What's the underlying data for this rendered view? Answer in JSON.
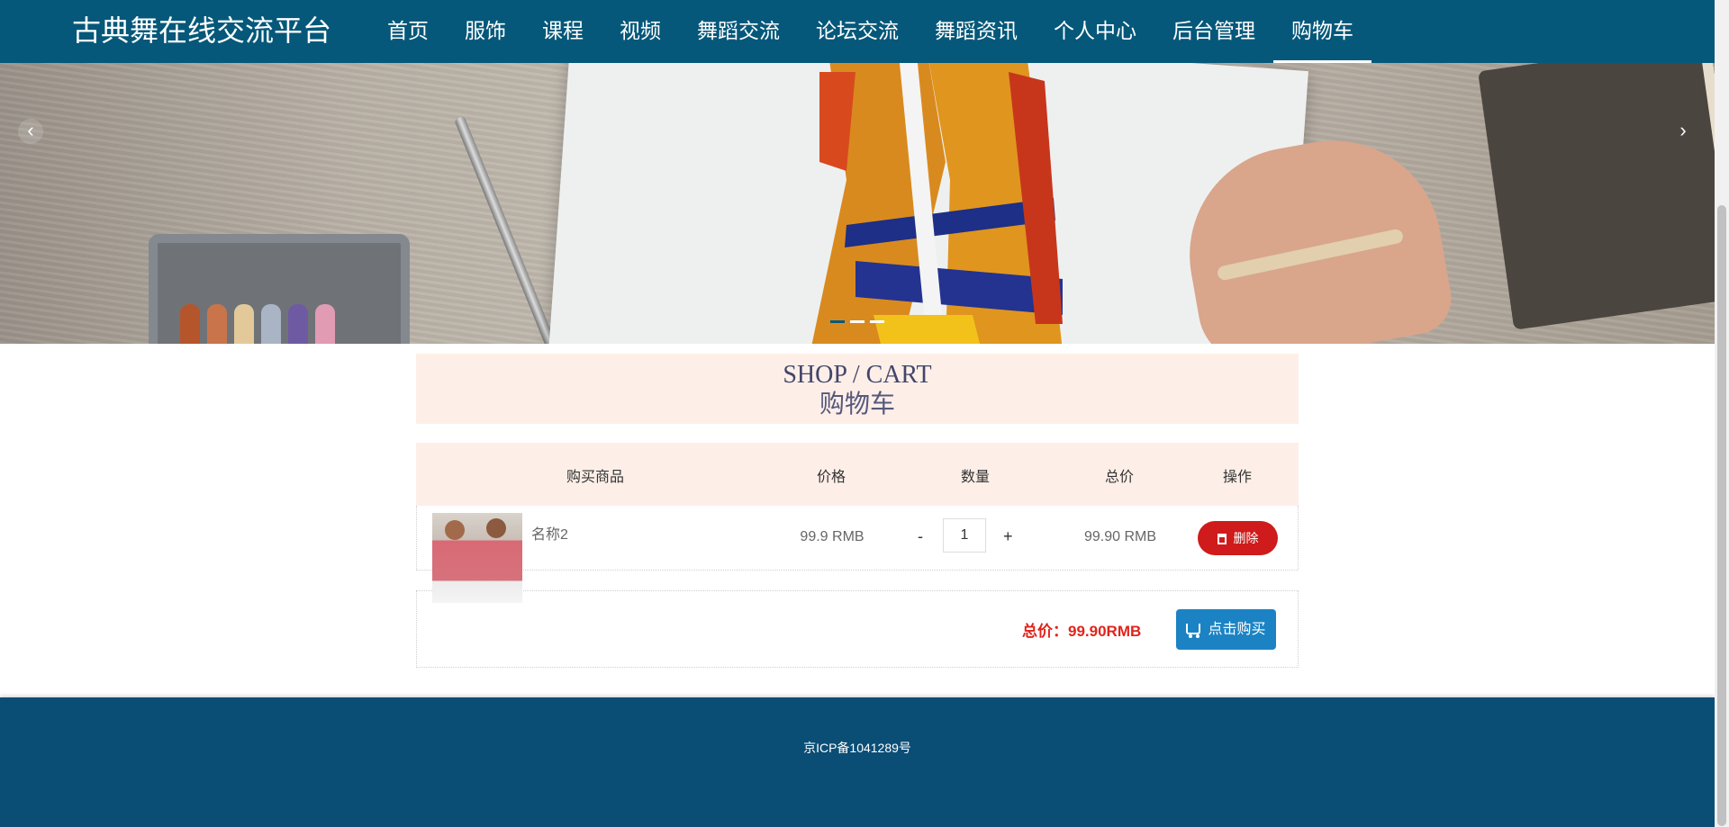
{
  "header": {
    "brand": "古典舞在线交流平台",
    "nav": [
      {
        "label": "首页"
      },
      {
        "label": "服饰"
      },
      {
        "label": "课程"
      },
      {
        "label": "视频"
      },
      {
        "label": "舞蹈交流"
      },
      {
        "label": "论坛交流"
      },
      {
        "label": "舞蹈资讯"
      },
      {
        "label": "个人中心"
      },
      {
        "label": "后台管理"
      },
      {
        "label": "购物车"
      }
    ],
    "active_nav": "购物车"
  },
  "banner": {
    "prev_icon": "chevron-left-icon",
    "next_icon": "chevron-right-icon",
    "prev_symbol": "‹",
    "next_symbol": "›",
    "slide_count": 3,
    "active_slide": 1
  },
  "section": {
    "title_en": "SHOP / CART",
    "title_cn": "购物车"
  },
  "cart": {
    "columns": [
      "购买商品",
      "价格",
      "数量",
      "总价",
      "操作"
    ],
    "items": [
      {
        "name": "名称2",
        "price": "99.9 RMB",
        "quantity": "1",
        "minus": "-",
        "plus": "+",
        "total": "99.90 RMB",
        "delete_label": "删除",
        "delete_icon": "trash-icon"
      }
    ],
    "summary": {
      "total_label": "总价：99.90RMB",
      "buy_label": "点击购买",
      "buy_icon": "cart-icon"
    }
  },
  "footer": {
    "icp": "京ICP备1041289号"
  },
  "colors": {
    "nav_bg": "#05587a",
    "title_bg": "#fdefe8",
    "delete": "#cf1b1b",
    "buy": "#1b83c4",
    "total_text": "#e2231a",
    "footer_bg": "#0a4e76"
  }
}
